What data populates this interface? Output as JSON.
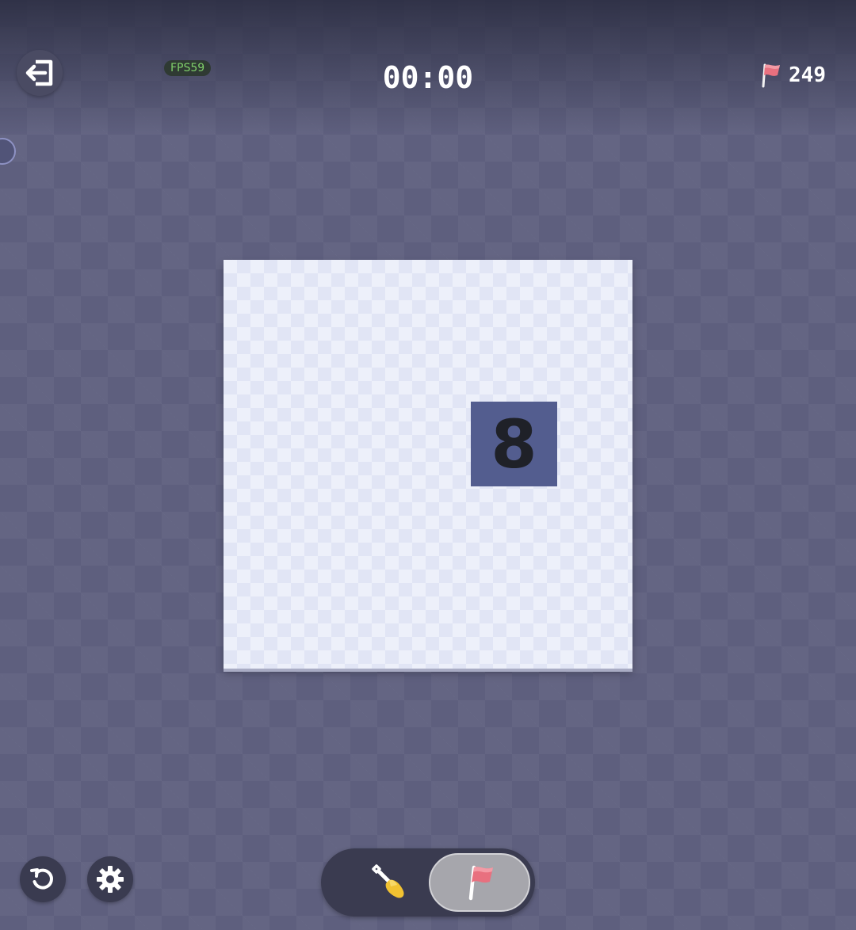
{
  "header": {
    "exit_icon": "exit-icon",
    "fps": "FPS59",
    "timer": "00:00",
    "flag_icon": "flag-icon",
    "flags_left": "249"
  },
  "board": {
    "revealed_cell_value": "8"
  },
  "footer": {
    "restart_icon": "restart-icon",
    "settings_icon": "gear-icon",
    "modes": [
      {
        "name": "dig",
        "icon": "shovel-icon",
        "active": false
      },
      {
        "name": "flag",
        "icon": "flag-icon",
        "active": true
      }
    ]
  },
  "colors": {
    "background": "#5e5f7e",
    "board": "#edf0fa",
    "revealed_cell": "#535d8f",
    "flag": "#e8707f",
    "fps_text": "#7fcf6a"
  }
}
